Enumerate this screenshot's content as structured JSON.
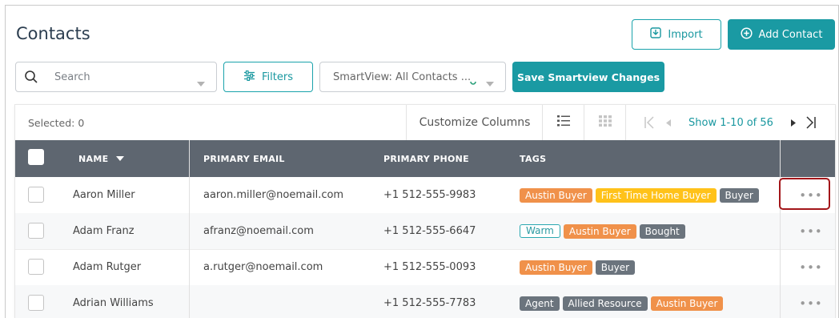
{
  "header": {
    "title": "Contacts",
    "import_label": "Import",
    "add_contact_label": "Add Contact"
  },
  "controls": {
    "search_placeholder": "Search",
    "filters_label": "Filters",
    "smartview_value": "SmartView: All Contacts ...",
    "save_smartview_label": "Save Smartview Changes"
  },
  "toolbar": {
    "selected": "Selected: 0",
    "customize_columns": "Customize Columns",
    "pagination_show": "Show 1-10",
    "pagination_of": "of 56"
  },
  "table": {
    "columns": [
      "NAME",
      "PRIMARY EMAIL",
      "PRIMARY PHONE",
      "TAGS"
    ],
    "rows": [
      {
        "name": "Aaron Miller",
        "email": "aaron.miller@noemail.com",
        "phone": "+1 512-555-9983",
        "tags": [
          {
            "label": "Austin Buyer",
            "style": "orange"
          },
          {
            "label": "First Time Home Buyer",
            "style": "yellow"
          },
          {
            "label": "Buyer",
            "style": "gray"
          }
        ]
      },
      {
        "name": "Adam Franz",
        "email": "afranz@noemail.com",
        "phone": "+1 512-555-6647",
        "tags": [
          {
            "label": "Warm",
            "style": "outline"
          },
          {
            "label": "Austin Buyer",
            "style": "orange"
          },
          {
            "label": "Bought",
            "style": "gray"
          }
        ]
      },
      {
        "name": "Adam Rutger",
        "email": "a.rutger@noemail.com",
        "phone": "+1 512-555-0093",
        "tags": [
          {
            "label": "Austin Buyer",
            "style": "orange"
          },
          {
            "label": "Buyer",
            "style": "gray"
          }
        ]
      },
      {
        "name": "Adrian Williams",
        "email": "",
        "phone": "+1 512-555-7783",
        "tags": [
          {
            "label": "Agent",
            "style": "gray"
          },
          {
            "label": "Allied Resource",
            "style": "gray"
          },
          {
            "label": "Austin Buyer",
            "style": "orange"
          }
        ]
      }
    ],
    "row_action_icon": "more-dots-icon"
  },
  "colors": {
    "accent": "#1a9aa3",
    "header_bg": "#5e6670",
    "tag_orange": "#f0914a",
    "tag_yellow": "#ffc21a",
    "tag_gray": "#6b747d",
    "highlight": "#a3161a"
  }
}
